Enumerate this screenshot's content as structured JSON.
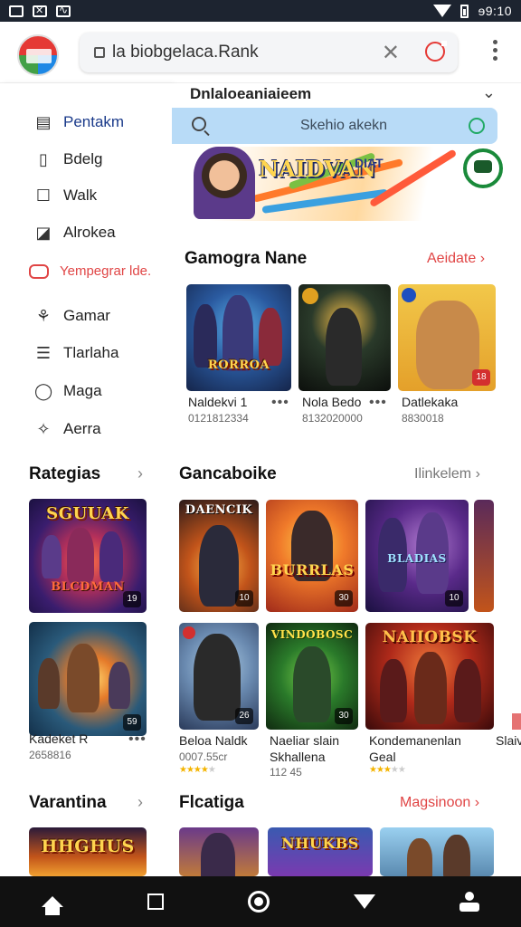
{
  "status_bar": {
    "time": "ɘ9:10"
  },
  "browser": {
    "url": "la biobgelaca.Rank",
    "close_label": "✕"
  },
  "sidebar": {
    "items": [
      {
        "label": "Pentakm",
        "icon": "inbox-icon"
      },
      {
        "label": "Bdelg",
        "icon": "book-icon"
      },
      {
        "label": "Walk",
        "icon": "square-icon"
      },
      {
        "label": "Alrokea",
        "icon": "edit-icon"
      },
      {
        "label": "Yempegrar lde.",
        "icon": "tag-icon"
      },
      {
        "label": "Gamar",
        "icon": "gamepad-icon"
      },
      {
        "label": "Tlarlaha",
        "icon": "list-icon"
      },
      {
        "label": "Maga",
        "icon": "circle-icon"
      },
      {
        "label": "Aerra",
        "icon": "sparkle-icon"
      }
    ],
    "section1_title": "Rategias",
    "section1_thumbs": [
      {
        "title_top": "SGUUAK",
        "title_bottom": "BLCDMAN",
        "badge": "19"
      },
      {
        "badge": "59"
      }
    ],
    "caption_title": "Kadeket R",
    "caption_sub": "2658816",
    "section2_title": "Varantina",
    "section2_thumb_title": "HHGHUS"
  },
  "main": {
    "heading": "Dnlaloeaniaieem",
    "search_placeholder": "Skehio akekn",
    "banner": {
      "title": "NAIDVAN",
      "tag": "DIAT"
    },
    "section1": {
      "title": "Gamogra Nane",
      "link": "Aeidate",
      "cards": [
        {
          "image_text": "RORROA",
          "title": "Naldekvi 1",
          "sub": "0121812334"
        },
        {
          "title": "Nola Bedo",
          "sub": "8132020000"
        },
        {
          "badge": "18",
          "title": "Datlekaka",
          "sub": "8830018"
        }
      ]
    },
    "section2": {
      "title": "Gancaboike",
      "link": "Ilinkelem",
      "row1": [
        {
          "image_text": "DAENCIK",
          "badge": "10"
        },
        {
          "image_text": "BURRLAS",
          "badge": "30"
        },
        {
          "image_text": "BLADIAS",
          "badge": "10"
        }
      ],
      "row2": [
        {
          "badge": "26",
          "title": "Beloa Naldk",
          "sub": "0007.55cr",
          "rating": 4
        },
        {
          "image_text": "VINDOBOSC",
          "badge": "30",
          "title": "Naeliar slain",
          "title2": "Skhallena",
          "sub": "112 45"
        },
        {
          "image_text": "NAIIOBSK",
          "title": "Kondemanenlan",
          "title2": "Geal",
          "rating": 3
        },
        {
          "title": "Slaiv"
        }
      ]
    },
    "section3": {
      "title": "Flcatiga",
      "link": "Magsinoon",
      "cards": [
        {},
        {
          "image_text": "NHUKBS"
        },
        {}
      ]
    }
  },
  "colors": {
    "accent_red": "#e04545",
    "search_bg": "#b8dbf7",
    "nav_active": "#1a3a8a"
  }
}
